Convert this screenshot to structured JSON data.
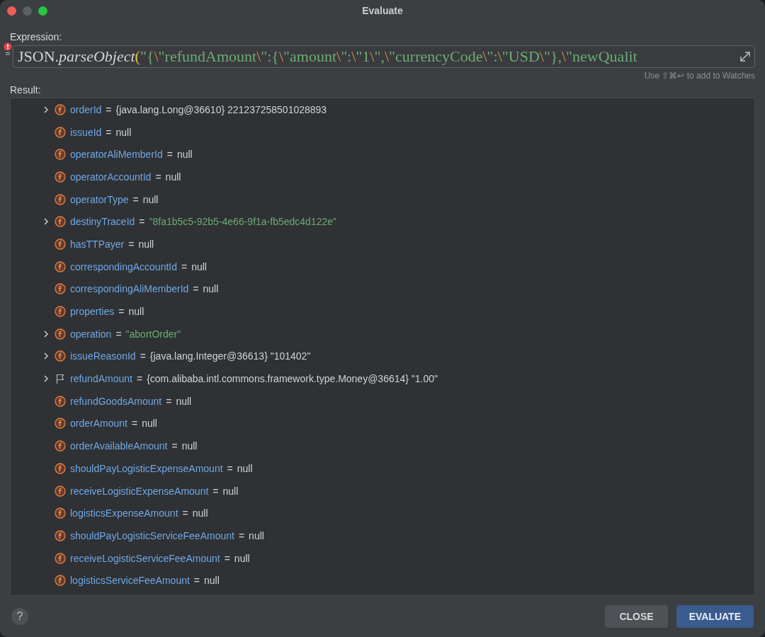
{
  "window": {
    "title": "Evaluate"
  },
  "expression": {
    "label": "Expression:",
    "has_error": true,
    "tokens": [
      {
        "text": "JSON",
        "kind": "plain"
      },
      {
        "text": ".",
        "kind": "plain"
      },
      {
        "text": "parseObject",
        "kind": "method"
      },
      {
        "text": "(",
        "kind": "paren"
      },
      {
        "text": "\"{",
        "kind": "string"
      },
      {
        "text": "\\",
        "kind": "escape"
      },
      {
        "text": "\"refundAmount",
        "kind": "string"
      },
      {
        "text": "\\",
        "kind": "escape"
      },
      {
        "text": "\":{",
        "kind": "string"
      },
      {
        "text": "\\",
        "kind": "escape"
      },
      {
        "text": "\"amount",
        "kind": "string"
      },
      {
        "text": "\\",
        "kind": "escape"
      },
      {
        "text": "\":",
        "kind": "string"
      },
      {
        "text": "\\",
        "kind": "escape"
      },
      {
        "text": "\"1",
        "kind": "string"
      },
      {
        "text": "\\",
        "kind": "escape"
      },
      {
        "text": "\",",
        "kind": "string"
      },
      {
        "text": "\\",
        "kind": "escape"
      },
      {
        "text": "\"currencyCode",
        "kind": "string"
      },
      {
        "text": "\\",
        "kind": "escape"
      },
      {
        "text": "\":",
        "kind": "string"
      },
      {
        "text": "\\",
        "kind": "escape"
      },
      {
        "text": "\"USD",
        "kind": "string"
      },
      {
        "text": "\\",
        "kind": "escape"
      },
      {
        "text": "\"},",
        "kind": "string"
      },
      {
        "text": "\\",
        "kind": "escape"
      },
      {
        "text": "\"newQualit",
        "kind": "string"
      }
    ],
    "hint": "Use ⇧⌘↩ to add to Watches"
  },
  "result": {
    "label": "Result:",
    "rows": [
      {
        "expandable": true,
        "kind": "field",
        "name": "orderId",
        "separator": "=",
        "value": "{java.lang.Long@36610} 221237258501028893"
      },
      {
        "expandable": false,
        "kind": "field",
        "name": "issueId",
        "separator": "=",
        "value": "null"
      },
      {
        "expandable": false,
        "kind": "field",
        "name": "operatorAliMemberId",
        "separator": "=",
        "value": "null"
      },
      {
        "expandable": false,
        "kind": "field",
        "name": "operatorAccountId",
        "separator": "=",
        "value": "null"
      },
      {
        "expandable": false,
        "kind": "field",
        "name": "operatorType",
        "separator": "=",
        "value": "null"
      },
      {
        "expandable": true,
        "kind": "field",
        "name": "destinyTraceId",
        "separator": "=",
        "string_value": "\"8fa1b5c5-92b5-4e66-9f1a-fb5edc4d122e\""
      },
      {
        "expandable": false,
        "kind": "field",
        "name": "hasTTPayer",
        "separator": "=",
        "value": "null"
      },
      {
        "expandable": false,
        "kind": "field",
        "name": "correspondingAccountId",
        "separator": "=",
        "value": "null"
      },
      {
        "expandable": false,
        "kind": "field",
        "name": "correspondingAliMemberId",
        "separator": "=",
        "value": "null"
      },
      {
        "expandable": false,
        "kind": "field",
        "name": "properties",
        "separator": "=",
        "value": "null"
      },
      {
        "expandable": true,
        "kind": "field",
        "name": "operation",
        "separator": "=",
        "string_value": "\"abortOrder\""
      },
      {
        "expandable": true,
        "kind": "field",
        "name": "issueReasonId",
        "separator": "=",
        "value": "{java.lang.Integer@36613} \"101402\""
      },
      {
        "expandable": true,
        "kind": "flagged",
        "name": "refundAmount",
        "separator": "=",
        "value": "{com.alibaba.intl.commons.framework.type.Money@36614} \"1.00\""
      },
      {
        "expandable": false,
        "kind": "field",
        "name": "refundGoodsAmount",
        "separator": "=",
        "value": "null"
      },
      {
        "expandable": false,
        "kind": "field",
        "name": "orderAmount",
        "separator": "=",
        "value": "null"
      },
      {
        "expandable": false,
        "kind": "field",
        "name": "orderAvailableAmount",
        "separator": "=",
        "value": "null"
      },
      {
        "expandable": false,
        "kind": "field",
        "name": "shouldPayLogisticExpenseAmount",
        "separator": "=",
        "value": "null"
      },
      {
        "expandable": false,
        "kind": "field",
        "name": "receiveLogisticExpenseAmount",
        "separator": "=",
        "value": "null"
      },
      {
        "expandable": false,
        "kind": "field",
        "name": "logisticsExpenseAmount",
        "separator": "=",
        "value": "null"
      },
      {
        "expandable": false,
        "kind": "field",
        "name": "shouldPayLogisticServiceFeeAmount",
        "separator": "=",
        "value": "null"
      },
      {
        "expandable": false,
        "kind": "field",
        "name": "receiveLogisticServiceFeeAmount",
        "separator": "=",
        "value": "null"
      },
      {
        "expandable": false,
        "kind": "field",
        "name": "logisticsServiceFeeAmount",
        "separator": "=",
        "value": "null"
      }
    ]
  },
  "help": {
    "symbol": "?"
  },
  "buttons": [
    {
      "label": "CLOSE",
      "kind": "secondary"
    },
    {
      "label": "EVALUATE",
      "kind": "primary"
    }
  ]
}
